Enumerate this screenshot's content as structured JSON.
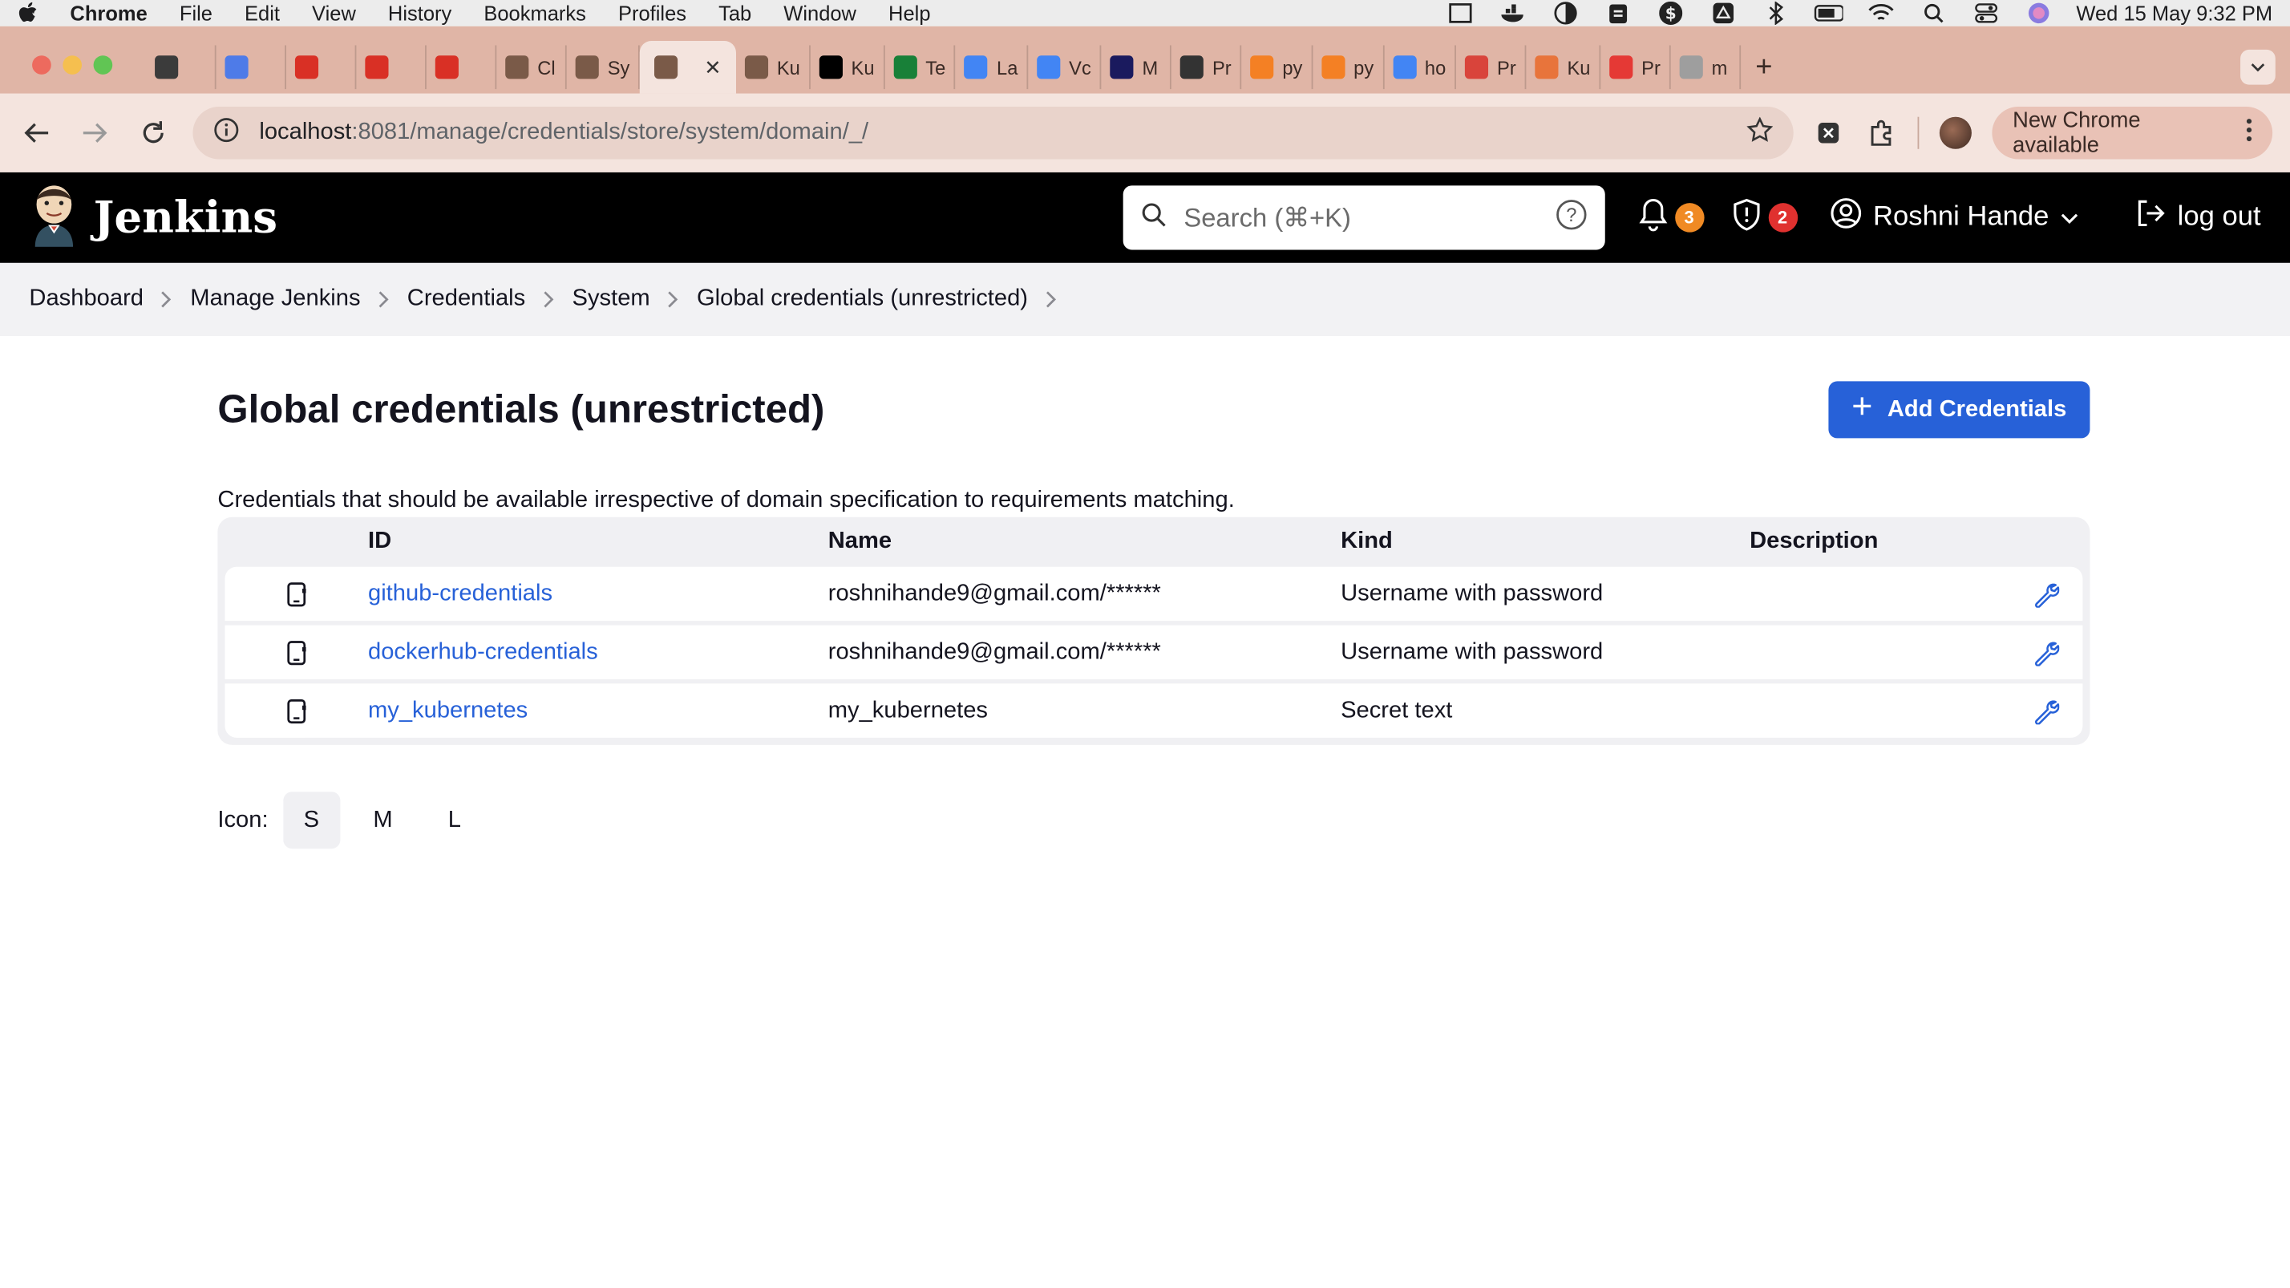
{
  "menubar": {
    "app": "Chrome",
    "items": [
      "File",
      "Edit",
      "View",
      "History",
      "Bookmarks",
      "Profiles",
      "Tab",
      "Window",
      "Help"
    ],
    "clock": "Wed 15 May  9:32 PM"
  },
  "tabs": [
    {
      "label": "",
      "icon": "chatgpt-icon",
      "color": "#3b3b3b"
    },
    {
      "label": "",
      "icon": "gemini-icon",
      "color": "#4e7be8"
    },
    {
      "label": "",
      "icon": "gmail-icon",
      "color": "#d93025"
    },
    {
      "label": "",
      "icon": "gmail-icon",
      "color": "#d93025"
    },
    {
      "label": "",
      "icon": "gmail-icon",
      "color": "#d93025"
    },
    {
      "label": "Cl",
      "icon": "jenkins-icon",
      "color": "#7a5a48"
    },
    {
      "label": "Sy",
      "icon": "jenkins-icon",
      "color": "#7a5a48"
    },
    {
      "label": "",
      "icon": "jenkins-icon",
      "color": "#7a5a48",
      "active": true
    },
    {
      "label": "Ku",
      "icon": "jenkins-icon",
      "color": "#7a5a48"
    },
    {
      "label": "Ku",
      "icon": "medium-icon",
      "color": "#000000"
    },
    {
      "label": "Te",
      "icon": "sheets-icon",
      "color": "#188038"
    },
    {
      "label": "La",
      "icon": "docs-icon",
      "color": "#4285f4"
    },
    {
      "label": "Vc",
      "icon": "docs-icon",
      "color": "#4285f4"
    },
    {
      "label": "M",
      "icon": "circle-icon",
      "color": "#1a1a5e"
    },
    {
      "label": "Pr",
      "icon": "person-icon",
      "color": "#333333"
    },
    {
      "label": "py",
      "icon": "stackoverflow-icon",
      "color": "#f48024"
    },
    {
      "label": "py",
      "icon": "stackoverflow-icon",
      "color": "#f48024"
    },
    {
      "label": "ho",
      "icon": "google-icon",
      "color": "#4285f4"
    },
    {
      "label": "Pr",
      "icon": "mic-icon",
      "color": "#d9443b"
    },
    {
      "label": "Ku",
      "icon": "kubernetes-icon",
      "color": "#e8743b"
    },
    {
      "label": "Pr",
      "icon": "pdf-icon",
      "color": "#e53935"
    },
    {
      "label": "m",
      "icon": "globe-icon",
      "color": "#9e9e9e"
    }
  ],
  "address": {
    "host": "localhost",
    "path": ":8081/manage/credentials/store/system/domain/_/"
  },
  "update_pill": "New Chrome available",
  "jenkins": {
    "brand": "Jenkins",
    "search_placeholder": "Search (⌘+K)",
    "notifications_count": "3",
    "security_count": "2",
    "user": "Roshni Hande",
    "logout": "log out"
  },
  "breadcrumb": [
    "Dashboard",
    "Manage Jenkins",
    "Credentials",
    "System",
    "Global credentials (unrestricted)"
  ],
  "page": {
    "title": "Global credentials (unrestricted)",
    "add_button": "Add Credentials",
    "description": "Credentials that should be available irrespective of domain specification to requirements matching."
  },
  "table": {
    "headers": {
      "id": "ID",
      "name": "Name",
      "kind": "Kind",
      "description": "Description"
    },
    "rows": [
      {
        "id": "github-credentials",
        "name": "roshnihande9@gmail.com/******",
        "kind": "Username with password",
        "description": ""
      },
      {
        "id": "dockerhub-credentials",
        "name": "roshnihande9@gmail.com/******",
        "kind": "Username with password",
        "description": ""
      },
      {
        "id": "my_kubernetes",
        "name": "my_kubernetes",
        "kind": "Secret text",
        "description": ""
      }
    ]
  },
  "icon_size": {
    "label": "Icon:",
    "options": [
      "S",
      "M",
      "L"
    ],
    "selected": "S"
  },
  "colors": {
    "accent": "#2761d8",
    "notification_badge": "#f08a24",
    "security_badge": "#e0312f",
    "tab_strip": "#e0b5a6"
  }
}
